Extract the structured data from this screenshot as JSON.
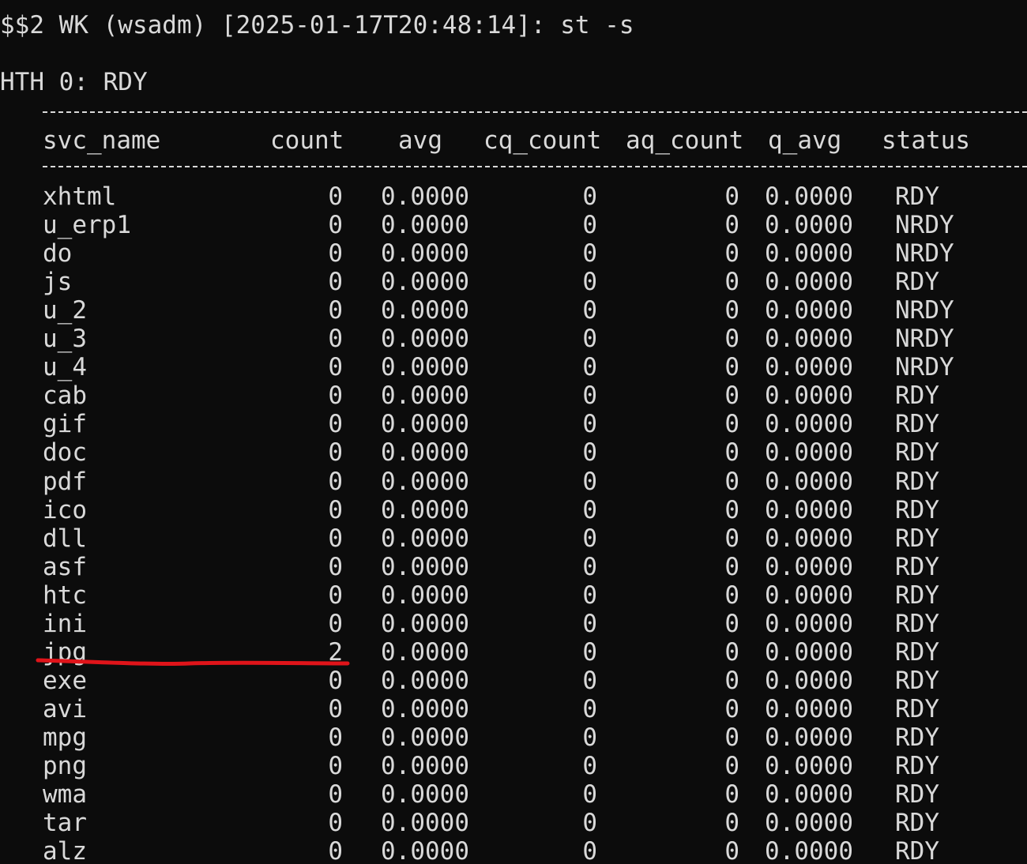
{
  "terminal": {
    "prompt": "$$2 WK (wsadm) [2025-01-17T20:48:14]: st -s",
    "hth_status": "HTH 0: RDY",
    "accent_colors": {
      "background": "#0c0c0c",
      "text": "#d9d9d9",
      "annotation": "#e0141a"
    },
    "separator": "----------------------------------------------------------------------------------------------------",
    "columns": {
      "svc_name": "svc_name",
      "count": "count",
      "avg": "avg",
      "cq_count": "cq_count",
      "aq_count": "aq_count",
      "q_avg": "q_avg",
      "status": "status"
    },
    "rows": [
      {
        "svc_name": "xhtml",
        "count": "0",
        "avg": "0.0000",
        "cq_count": "0",
        "aq_count": "0",
        "q_avg": "0.0000",
        "status": "RDY"
      },
      {
        "svc_name": "u_erp1",
        "count": "0",
        "avg": "0.0000",
        "cq_count": "0",
        "aq_count": "0",
        "q_avg": "0.0000",
        "status": "NRDY"
      },
      {
        "svc_name": "do",
        "count": "0",
        "avg": "0.0000",
        "cq_count": "0",
        "aq_count": "0",
        "q_avg": "0.0000",
        "status": "NRDY"
      },
      {
        "svc_name": "js",
        "count": "0",
        "avg": "0.0000",
        "cq_count": "0",
        "aq_count": "0",
        "q_avg": "0.0000",
        "status": "RDY"
      },
      {
        "svc_name": "u_2",
        "count": "0",
        "avg": "0.0000",
        "cq_count": "0",
        "aq_count": "0",
        "q_avg": "0.0000",
        "status": "NRDY"
      },
      {
        "svc_name": "u_3",
        "count": "0",
        "avg": "0.0000",
        "cq_count": "0",
        "aq_count": "0",
        "q_avg": "0.0000",
        "status": "NRDY"
      },
      {
        "svc_name": "u_4",
        "count": "0",
        "avg": "0.0000",
        "cq_count": "0",
        "aq_count": "0",
        "q_avg": "0.0000",
        "status": "NRDY"
      },
      {
        "svc_name": "cab",
        "count": "0",
        "avg": "0.0000",
        "cq_count": "0",
        "aq_count": "0",
        "q_avg": "0.0000",
        "status": "RDY"
      },
      {
        "svc_name": "gif",
        "count": "0",
        "avg": "0.0000",
        "cq_count": "0",
        "aq_count": "0",
        "q_avg": "0.0000",
        "status": "RDY"
      },
      {
        "svc_name": "doc",
        "count": "0",
        "avg": "0.0000",
        "cq_count": "0",
        "aq_count": "0",
        "q_avg": "0.0000",
        "status": "RDY"
      },
      {
        "svc_name": "pdf",
        "count": "0",
        "avg": "0.0000",
        "cq_count": "0",
        "aq_count": "0",
        "q_avg": "0.0000",
        "status": "RDY"
      },
      {
        "svc_name": "ico",
        "count": "0",
        "avg": "0.0000",
        "cq_count": "0",
        "aq_count": "0",
        "q_avg": "0.0000",
        "status": "RDY"
      },
      {
        "svc_name": "dll",
        "count": "0",
        "avg": "0.0000",
        "cq_count": "0",
        "aq_count": "0",
        "q_avg": "0.0000",
        "status": "RDY"
      },
      {
        "svc_name": "asf",
        "count": "0",
        "avg": "0.0000",
        "cq_count": "0",
        "aq_count": "0",
        "q_avg": "0.0000",
        "status": "RDY"
      },
      {
        "svc_name": "htc",
        "count": "0",
        "avg": "0.0000",
        "cq_count": "0",
        "aq_count": "0",
        "q_avg": "0.0000",
        "status": "RDY"
      },
      {
        "svc_name": "ini",
        "count": "0",
        "avg": "0.0000",
        "cq_count": "0",
        "aq_count": "0",
        "q_avg": "0.0000",
        "status": "RDY"
      },
      {
        "svc_name": "jpg",
        "count": "2",
        "avg": "0.0000",
        "cq_count": "0",
        "aq_count": "0",
        "q_avg": "0.0000",
        "status": "RDY",
        "highlighted": true
      },
      {
        "svc_name": "exe",
        "count": "0",
        "avg": "0.0000",
        "cq_count": "0",
        "aq_count": "0",
        "q_avg": "0.0000",
        "status": "RDY"
      },
      {
        "svc_name": "avi",
        "count": "0",
        "avg": "0.0000",
        "cq_count": "0",
        "aq_count": "0",
        "q_avg": "0.0000",
        "status": "RDY"
      },
      {
        "svc_name": "mpg",
        "count": "0",
        "avg": "0.0000",
        "cq_count": "0",
        "aq_count": "0",
        "q_avg": "0.0000",
        "status": "RDY"
      },
      {
        "svc_name": "png",
        "count": "0",
        "avg": "0.0000",
        "cq_count": "0",
        "aq_count": "0",
        "q_avg": "0.0000",
        "status": "RDY"
      },
      {
        "svc_name": "wma",
        "count": "0",
        "avg": "0.0000",
        "cq_count": "0",
        "aq_count": "0",
        "q_avg": "0.0000",
        "status": "RDY"
      },
      {
        "svc_name": "tar",
        "count": "0",
        "avg": "0.0000",
        "cq_count": "0",
        "aq_count": "0",
        "q_avg": "0.0000",
        "status": "RDY"
      },
      {
        "svc_name": "alz",
        "count": "0",
        "avg": "0.0000",
        "cq_count": "0",
        "aq_count": "0",
        "q_avg": "0.0000",
        "status": "RDY"
      }
    ]
  }
}
